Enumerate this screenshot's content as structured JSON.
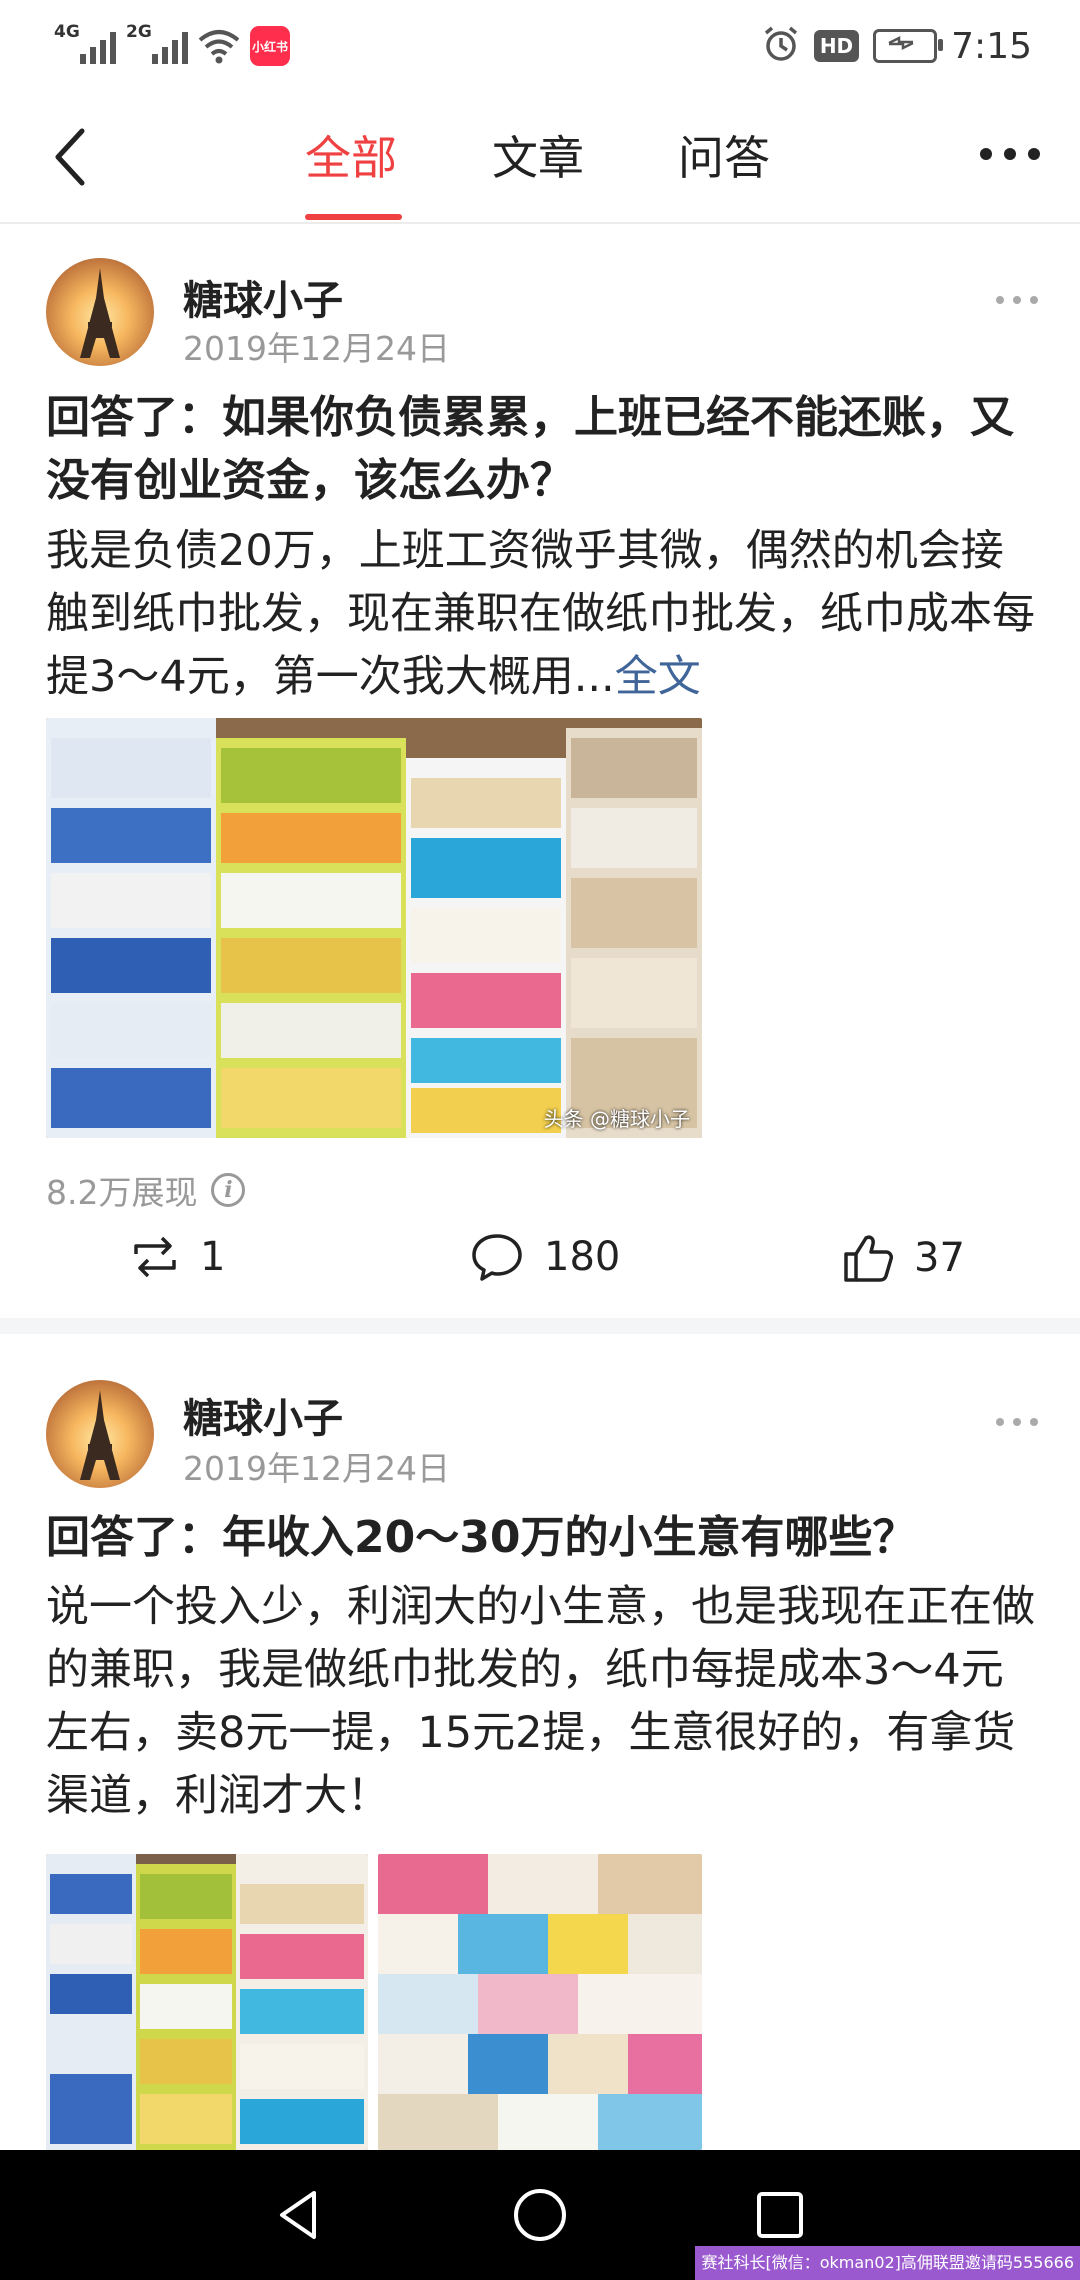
{
  "status_bar": {
    "sig1_label": "4G",
    "sig2_label": "2G",
    "app_badge": "小红书",
    "hd": "HD",
    "time": "7:15",
    "battery_level": 0.9
  },
  "top_nav": {
    "tabs": [
      {
        "label": "全部",
        "active": true
      },
      {
        "label": "文章",
        "active": false
      },
      {
        "label": "问答",
        "active": false
      }
    ]
  },
  "posts": [
    {
      "author": "糖球小子",
      "date": "2019年12月24日",
      "title": "回答了：如果你负债累累，上班已经不能还账，又没有创业资金，该怎么办？",
      "body": "我是负债20万，上班工资微乎其微，偶然的机会接触到纸巾批发，现在兼职在做纸巾批发，纸巾成本每提3～4元，第一次我大概用...",
      "full_text_link": "全文",
      "image_watermark": "头条 @糖球小子",
      "views": "8.2万展现",
      "reposts": "1",
      "comments": "180",
      "likes": "37"
    },
    {
      "author": "糖球小子",
      "date": "2019年12月24日",
      "title": "回答了：年收入20～30万的小生意有哪些？",
      "body": "说一个投入少，利润大的小生意，也是我现在正在做的兼职，我是做纸巾批发的，纸巾每提成本3～4元左右，卖8元一提，15元2提，生意很好的，有拿货渠道，利润才大！"
    }
  ],
  "overlay_watermark": "赛社科长[微信：okman02]高佣联盟邀请码555666",
  "colors": {
    "accent": "#f04142",
    "link": "#406599",
    "muted": "#999999"
  },
  "icons": {
    "back": "chevron-left-icon",
    "more": "more-horizontal-icon",
    "repost": "repost-icon",
    "comment": "comment-icon",
    "like": "thumbs-up-icon"
  }
}
